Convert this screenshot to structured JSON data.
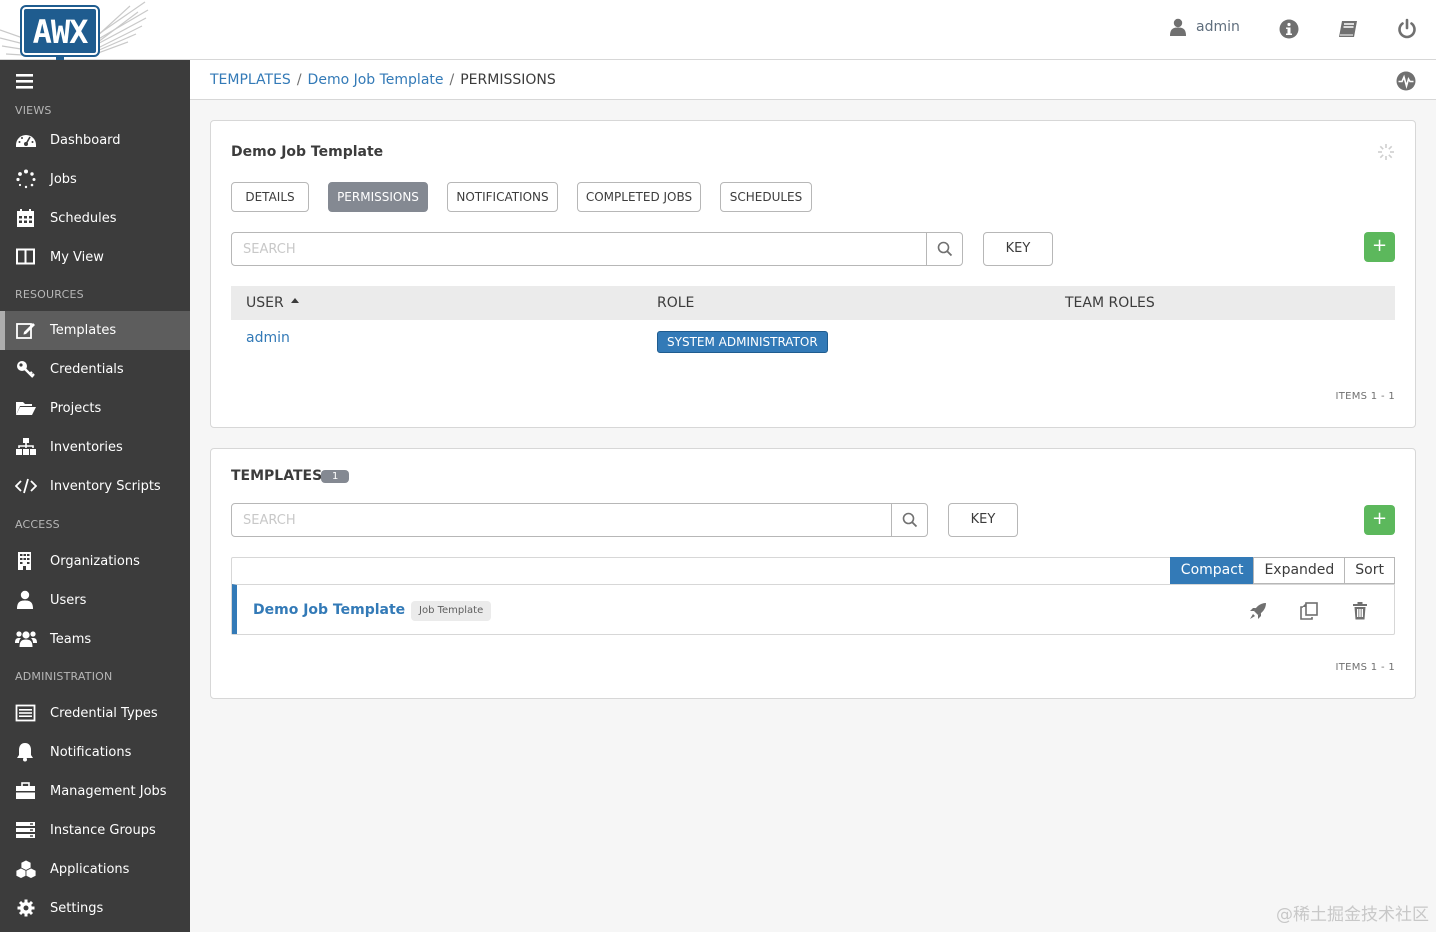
{
  "app": {
    "logo_text": "AWX"
  },
  "header": {
    "user": "admin",
    "icons": [
      "user-icon",
      "info-icon",
      "docs-book-icon",
      "logout-power-icon"
    ]
  },
  "sidebar": {
    "sections": [
      {
        "label": "VIEWS",
        "items": [
          {
            "label": "Dashboard",
            "icon": "dashboard-icon"
          },
          {
            "label": "Jobs",
            "icon": "jobs-spinner-icon"
          },
          {
            "label": "Schedules",
            "icon": "calendar-icon"
          },
          {
            "label": "My View",
            "icon": "columns-icon"
          }
        ]
      },
      {
        "label": "RESOURCES",
        "items": [
          {
            "label": "Templates",
            "icon": "edit-icon",
            "active": true
          },
          {
            "label": "Credentials",
            "icon": "key-icon"
          },
          {
            "label": "Projects",
            "icon": "folder-icon"
          },
          {
            "label": "Inventories",
            "icon": "sitemap-icon"
          },
          {
            "label": "Inventory Scripts",
            "icon": "code-icon"
          }
        ]
      },
      {
        "label": "ACCESS",
        "items": [
          {
            "label": "Organizations",
            "icon": "building-icon"
          },
          {
            "label": "Users",
            "icon": "user-icon"
          },
          {
            "label": "Teams",
            "icon": "users-icon"
          }
        ]
      },
      {
        "label": "ADMINISTRATION",
        "items": [
          {
            "label": "Credential Types",
            "icon": "list-icon"
          },
          {
            "label": "Notifications",
            "icon": "bell-icon"
          },
          {
            "label": "Management Jobs",
            "icon": "briefcase-icon"
          },
          {
            "label": "Instance Groups",
            "icon": "server-icon"
          },
          {
            "label": "Applications",
            "icon": "cubes-icon"
          },
          {
            "label": "Settings",
            "icon": "cog-icon"
          }
        ]
      }
    ]
  },
  "breadcrumb": {
    "root": "TEMPLATES",
    "item": "Demo Job Template",
    "current": "PERMISSIONS"
  },
  "permissions_panel": {
    "title": "Demo Job Template",
    "tabs": [
      "DETAILS",
      "PERMISSIONS",
      "NOTIFICATIONS",
      "COMPLETED JOBS",
      "SCHEDULES"
    ],
    "active_tab": "PERMISSIONS",
    "search_placeholder": "SEARCH",
    "key_label": "KEY",
    "add_label": "+",
    "columns": [
      "USER",
      "ROLE",
      "TEAM ROLES"
    ],
    "rows": [
      {
        "user": "admin",
        "role": "SYSTEM ADMINISTRATOR",
        "team_roles": ""
      }
    ],
    "items_label": "ITEMS  1 - 1"
  },
  "templates_panel": {
    "title": "TEMPLATES",
    "count": "1",
    "search_placeholder": "SEARCH",
    "key_label": "KEY",
    "add_label": "+",
    "view_options": [
      "Compact",
      "Expanded",
      "Sort"
    ],
    "active_view": "Compact",
    "rows": [
      {
        "name": "Demo Job Template",
        "type": "Job Template",
        "actions": [
          "launch-rocket-icon",
          "copy-icon",
          "delete-trash-icon"
        ]
      }
    ],
    "items_label": "ITEMS  1 - 1"
  },
  "watermark": "@稀土掘金技术社区",
  "colors": {
    "brand": "#1f5c8f",
    "link": "#337ab7",
    "sidebar": "#3c3c3c",
    "add": "#5cb85c"
  }
}
